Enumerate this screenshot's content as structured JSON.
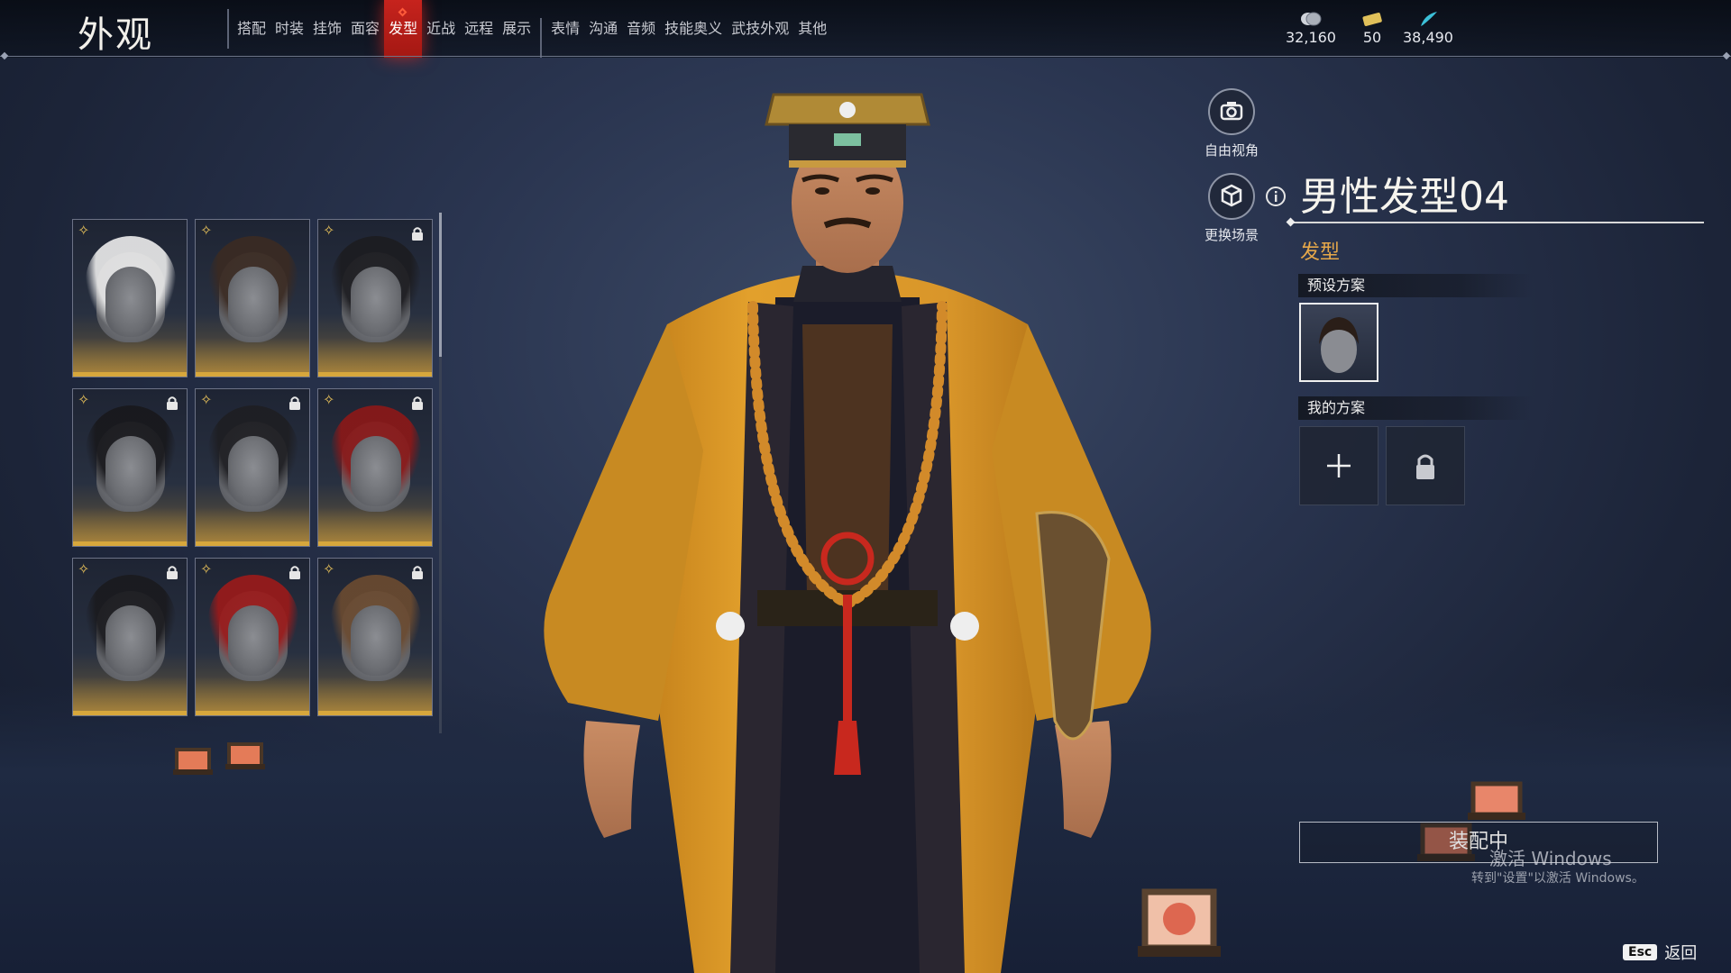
{
  "header": {
    "title": "外观",
    "tabs": [
      {
        "label": "搭配"
      },
      {
        "label": "时装"
      },
      {
        "label": "挂饰"
      },
      {
        "label": "面容"
      },
      {
        "label": "发型",
        "active": true
      },
      {
        "label": "近战"
      },
      {
        "label": "远程"
      },
      {
        "label": "展示"
      },
      {
        "label": "表情"
      },
      {
        "label": "沟通"
      },
      {
        "label": "音频"
      },
      {
        "label": "技能奥义"
      },
      {
        "label": "武技外观"
      },
      {
        "label": "其他"
      }
    ],
    "currencies": [
      {
        "icon": "silver-coin-icon",
        "value": "32,160"
      },
      {
        "icon": "ticket-icon",
        "value": "50"
      },
      {
        "icon": "feather-icon",
        "value": "38,490"
      }
    ]
  },
  "hair_grid": [
    {
      "hair_color": "#e8e8e8",
      "locked": false
    },
    {
      "hair_color": "#3a2a22",
      "locked": false
    },
    {
      "hair_color": "#1c1c20",
      "locked": true
    },
    {
      "hair_color": "#18181c",
      "locked": true
    },
    {
      "hair_color": "#1e1e22",
      "locked": true
    },
    {
      "hair_color": "#8a1818",
      "locked": true
    },
    {
      "hair_color": "#1a1a1e",
      "locked": true
    },
    {
      "hair_color": "#9a1a1a",
      "locked": true
    },
    {
      "hair_color": "#6a4a30",
      "locked": true
    }
  ],
  "camera": {
    "free_view_label": "自由视角",
    "change_scene_label": "更换场景"
  },
  "detail": {
    "item_name": "男性发型04",
    "category": "发型",
    "preset_section": "预设方案",
    "my_section": "我的方案",
    "equip_label": "装配中"
  },
  "watermark": {
    "line1": "激活 Windows",
    "line2": "转到\"设置\"以激活 Windows。"
  },
  "footer": {
    "esc_key": "Esc",
    "back_label": "返回"
  },
  "colors": {
    "accent_red": "#c6231d",
    "gold": "#d7a73c",
    "category_orange": "#e6a84a"
  }
}
